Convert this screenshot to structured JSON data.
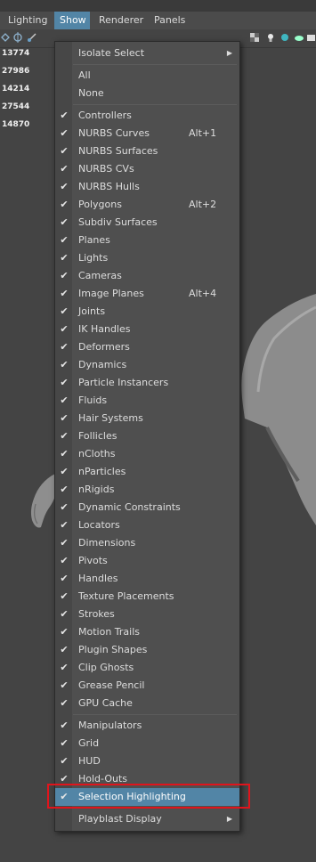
{
  "menubar": {
    "tabs": [
      {
        "label": "Lighting",
        "active": false
      },
      {
        "label": "Show",
        "active": true
      },
      {
        "label": "Renderer",
        "active": false
      },
      {
        "label": "Panels",
        "active": false
      }
    ]
  },
  "hud_stats": [
    "13774",
    "27986",
    "14214",
    "27544",
    "14870"
  ],
  "dropdown": {
    "items": [
      {
        "label": "Isolate Select",
        "checked": false,
        "shortcut": "",
        "submenu": true
      },
      {
        "label": "All",
        "checked": false,
        "shortcut": ""
      },
      {
        "label": "None",
        "checked": false,
        "shortcut": ""
      },
      {
        "label": "Controllers",
        "checked": true,
        "shortcut": ""
      },
      {
        "label": "NURBS Curves",
        "checked": true,
        "shortcut": "Alt+1"
      },
      {
        "label": "NURBS Surfaces",
        "checked": true,
        "shortcut": ""
      },
      {
        "label": "NURBS CVs",
        "checked": true,
        "shortcut": ""
      },
      {
        "label": "NURBS Hulls",
        "checked": true,
        "shortcut": ""
      },
      {
        "label": "Polygons",
        "checked": true,
        "shortcut": "Alt+2"
      },
      {
        "label": "Subdiv Surfaces",
        "checked": true,
        "shortcut": ""
      },
      {
        "label": "Planes",
        "checked": true,
        "shortcut": ""
      },
      {
        "label": "Lights",
        "checked": true,
        "shortcut": ""
      },
      {
        "label": "Cameras",
        "checked": true,
        "shortcut": ""
      },
      {
        "label": "Image Planes",
        "checked": true,
        "shortcut": "Alt+4"
      },
      {
        "label": "Joints",
        "checked": true,
        "shortcut": ""
      },
      {
        "label": "IK Handles",
        "checked": true,
        "shortcut": ""
      },
      {
        "label": "Deformers",
        "checked": true,
        "shortcut": ""
      },
      {
        "label": "Dynamics",
        "checked": true,
        "shortcut": ""
      },
      {
        "label": "Particle Instancers",
        "checked": true,
        "shortcut": ""
      },
      {
        "label": "Fluids",
        "checked": true,
        "shortcut": ""
      },
      {
        "label": "Hair Systems",
        "checked": true,
        "shortcut": ""
      },
      {
        "label": "Follicles",
        "checked": true,
        "shortcut": ""
      },
      {
        "label": "nCloths",
        "checked": true,
        "shortcut": ""
      },
      {
        "label": "nParticles",
        "checked": true,
        "shortcut": ""
      },
      {
        "label": "nRigids",
        "checked": true,
        "shortcut": ""
      },
      {
        "label": "Dynamic Constraints",
        "checked": true,
        "shortcut": ""
      },
      {
        "label": "Locators",
        "checked": true,
        "shortcut": ""
      },
      {
        "label": "Dimensions",
        "checked": true,
        "shortcut": ""
      },
      {
        "label": "Pivots",
        "checked": true,
        "shortcut": ""
      },
      {
        "label": "Handles",
        "checked": true,
        "shortcut": ""
      },
      {
        "label": "Texture Placements",
        "checked": true,
        "shortcut": ""
      },
      {
        "label": "Strokes",
        "checked": true,
        "shortcut": ""
      },
      {
        "label": "Motion Trails",
        "checked": true,
        "shortcut": ""
      },
      {
        "label": "Plugin Shapes",
        "checked": true,
        "shortcut": ""
      },
      {
        "label": "Clip Ghosts",
        "checked": true,
        "shortcut": ""
      },
      {
        "label": "Grease Pencil",
        "checked": true,
        "shortcut": ""
      },
      {
        "label": "GPU Cache",
        "checked": true,
        "shortcut": ""
      },
      {
        "label": "Manipulators",
        "checked": true,
        "shortcut": ""
      },
      {
        "label": "Grid",
        "checked": true,
        "shortcut": ""
      },
      {
        "label": "HUD",
        "checked": true,
        "shortcut": ""
      },
      {
        "label": "Hold-Outs",
        "checked": true,
        "shortcut": ""
      },
      {
        "label": "Selection Highlighting",
        "checked": true,
        "shortcut": "",
        "highlighted": true
      },
      {
        "label": "Playblast Display",
        "checked": false,
        "shortcut": "",
        "submenu": true
      }
    ],
    "check_icon": "check-icon",
    "submenu_icon": "arrow-right-icon"
  },
  "colors": {
    "highlight": "#5285a6",
    "annotation_box": "#e0141c"
  }
}
